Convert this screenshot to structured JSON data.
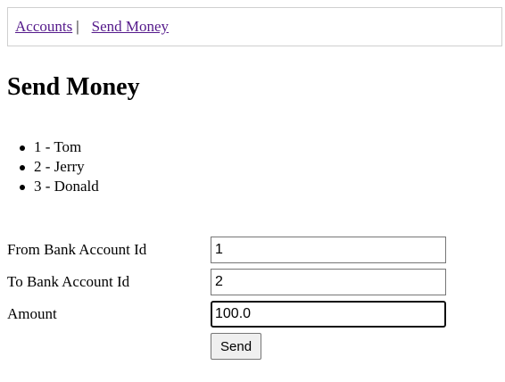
{
  "nav": {
    "accounts_label": "Accounts",
    "separator": "|",
    "send_money_label": "Send Money"
  },
  "page": {
    "title": "Send Money"
  },
  "accounts": [
    {
      "label": "1 - Tom"
    },
    {
      "label": "2 - Jerry"
    },
    {
      "label": "3 - Donald"
    }
  ],
  "form": {
    "from_label": "From Bank Account Id",
    "from_value": "1",
    "to_label": "To Bank Account Id",
    "to_value": "2",
    "amount_label": "Amount",
    "amount_value": "100.0",
    "send_label": "Send"
  },
  "colors": {
    "link": "#551a8b",
    "nav_border": "#cfcfcf",
    "button_bg": "#efefef",
    "input_border": "#767676"
  }
}
